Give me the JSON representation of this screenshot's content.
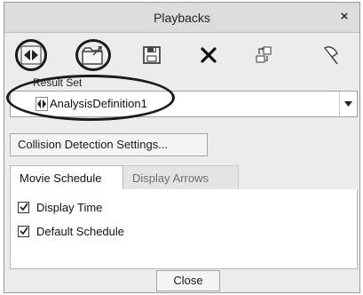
{
  "window": {
    "title": "Playbacks",
    "close_glyph": "×"
  },
  "toolbar": {
    "buttons": [
      {
        "name": "step-toggle-icon"
      },
      {
        "name": "open-folder-icon"
      },
      {
        "name": "save-icon"
      },
      {
        "name": "delete-icon"
      },
      {
        "name": "export-icon"
      },
      {
        "name": "pin-icon"
      }
    ]
  },
  "result_set": {
    "label": "Result Set",
    "value": "AnalysisDefinition1"
  },
  "settings_button": {
    "label": "Collision Detection Settings..."
  },
  "tabs": [
    {
      "label": "Movie Schedule",
      "active": true
    },
    {
      "label": "Display Arrows",
      "active": false
    }
  ],
  "options": [
    {
      "label": "Display Time",
      "checked": true
    },
    {
      "label": "Default Schedule",
      "checked": true
    }
  ],
  "footer": {
    "close_label": "Close"
  }
}
